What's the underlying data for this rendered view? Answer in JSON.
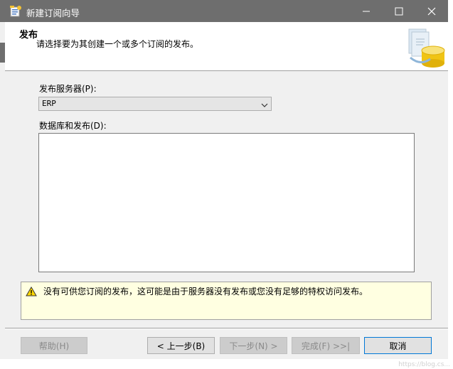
{
  "window": {
    "title": "新建订阅向导"
  },
  "header": {
    "title": "发布",
    "subtitle": "请选择要为其创建一个或多个订阅的发布。"
  },
  "publisher": {
    "label": "发布服务器(P):",
    "selected": "ERP"
  },
  "databases": {
    "label": "数据库和发布(D):",
    "items": []
  },
  "warning": {
    "text": "没有可供您订阅的发布，这可能是由于服务器没有发布或您没有足够的特权访问发布。"
  },
  "buttons": {
    "help": "帮助(H)",
    "back": "< 上一步(B)",
    "next": "下一步(N) >",
    "finish": "完成(F) >>|",
    "cancel": "取消"
  },
  "colors": {
    "titlebar": "#6e6e6e",
    "warning_bg": "#ffffe1",
    "focus": "#0078d7"
  },
  "watermark": "https://blog.cs..."
}
